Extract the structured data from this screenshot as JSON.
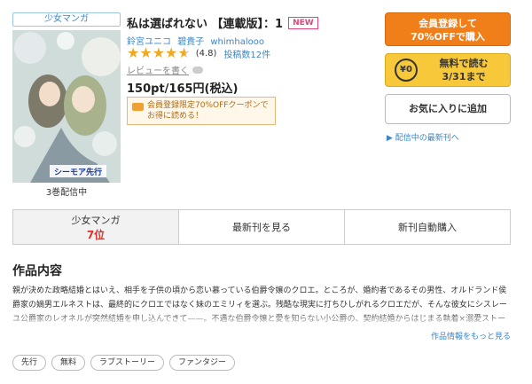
{
  "product": {
    "genre_badge": "少女マンガ",
    "title": "私は選ばれない 【連載版】：1",
    "new_badge": "NEW",
    "authors": [
      "鈴宮ユニコ",
      "碧貴子",
      "whimhalooo"
    ],
    "rating_value": "(4.8)",
    "rating_stars": 4.8,
    "review_count": "投稿数12件",
    "review_link": "レビューを書く",
    "price": "150pt/165円(税込)",
    "coupon_line1": "会員登録限定70%OFFクーポンで",
    "coupon_line2": "お得に読める！",
    "cover_stock": "3巻配信中",
    "cover_imprint": "シーモア先行"
  },
  "actions": {
    "register_line1": "会員登録して",
    "register_line2": "70%OFFで購入",
    "free_coin": "¥0",
    "free_line1": "無料で読む",
    "free_line2": "3/31まで",
    "favorite": "お気に入りに追加",
    "newest_link": "▶ 配信中の最新刊へ"
  },
  "tabs": [
    {
      "label": "少女マンガ",
      "sub": "7位"
    },
    {
      "label": "最新刊を見る"
    },
    {
      "label": "新刊自動購入"
    }
  ],
  "section": {
    "title": "作品内容",
    "description": "親が決めた政略結婚とはいえ、相手を子供の頃から恋い慕っている伯爵令嬢のクロエ。ところが、婚約者であるその男性、オルドランド侯爵家の嫡男エルネストは、最終的にクロエではなく妹のエミリィを選ぶ。残酷な現実に打ちひしがれるクロエだが、そんな彼女にシスレーユ公爵家のレオネルが突然結婚を申し込んできて——。不遇な伯爵令嬢と愛を知らない小公爵の、契約結婚からはじまる執着×溺愛ストーリー！【本商品は単話コンテンツとなります。単行本版と収録内容が異なる場合がございます。漫画内の告知等は過去のものとなりますので、ご注意ください",
    "more_link": "作品情報をもっと見る"
  },
  "tags": [
    "先行",
    "無料",
    "ラブストーリー",
    "ファンタジー"
  ],
  "colors": {
    "register": "#f07f1a",
    "free": "#f7c83a",
    "link": "#3a86c9",
    "rank": "#e0302a"
  }
}
